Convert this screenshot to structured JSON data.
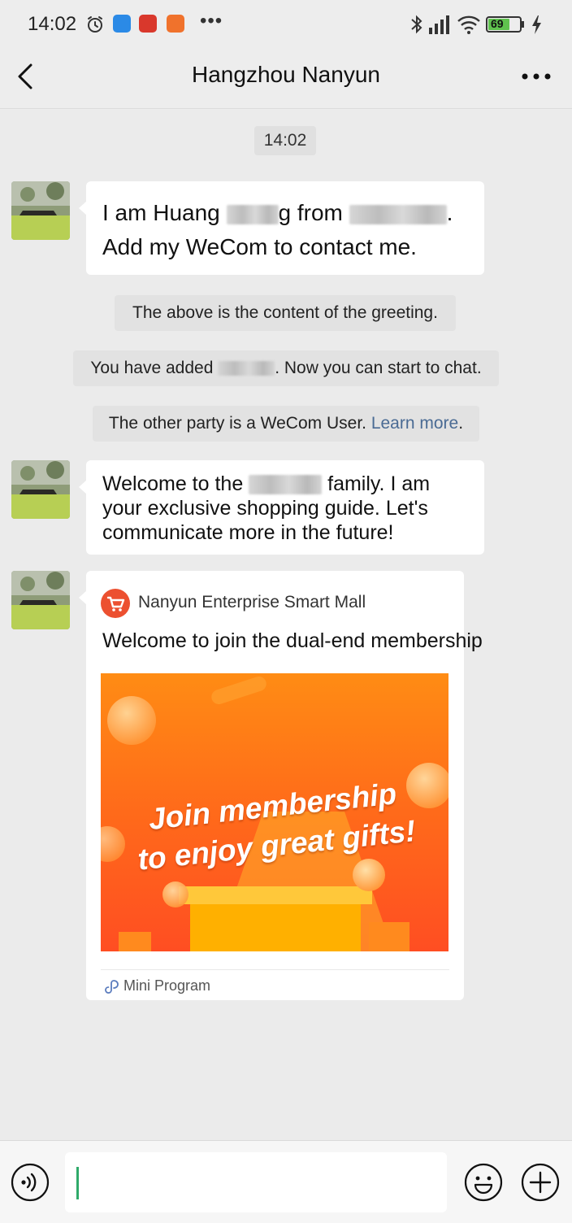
{
  "status_bar": {
    "time": "14:02",
    "more_indicator": "•••",
    "battery_level": "69",
    "icons": [
      "alarm-icon",
      "app-icon-blue",
      "app-icon-red",
      "app-icon-orange",
      "bluetooth-icon",
      "signal-icon",
      "wifi-icon",
      "battery-icon",
      "charging-icon"
    ]
  },
  "header": {
    "title": "Hangzhou Nanyun",
    "back_icon": "chevron-left-icon",
    "more_icon": "more-dots-icon"
  },
  "chat": {
    "timestamp": "14:02",
    "message1": {
      "part1": "I am Huang ",
      "part2": "g from ",
      "part3": ".",
      "line2": "Add my WeCom to contact me."
    },
    "notice_greeting": "The above is the content of the greeting.",
    "notice_added": {
      "before": "You have added ",
      "after": ". Now you can start to chat."
    },
    "notice_wecom": {
      "text": "The other party is a WeCom User. ",
      "link": "Learn more",
      "end": "."
    },
    "message2": {
      "line1_before": "Welcome to the ",
      "line1_after": " family. I am",
      "line2": "your exclusive shopping guide. Let's",
      "line3": "communicate more in the future!"
    },
    "mini_program_card": {
      "app_name": "Nanyun Enterprise Smart Mall",
      "title": "Welcome to join the dual-end membership",
      "banner_line1": "Join membership",
      "banner_line2": "to enjoy great gifts!",
      "footer_label": "Mini Program",
      "colors": {
        "banner_top": "#ff8c14",
        "banner_bottom": "#ff4e22",
        "logo": "#ec5030"
      }
    }
  },
  "input_bar": {
    "voice_icon": "voice-icon",
    "emoji_icon": "emoji-icon",
    "plus_icon": "plus-circle-icon",
    "input_value": "",
    "caret_color": "#2faa6a"
  }
}
